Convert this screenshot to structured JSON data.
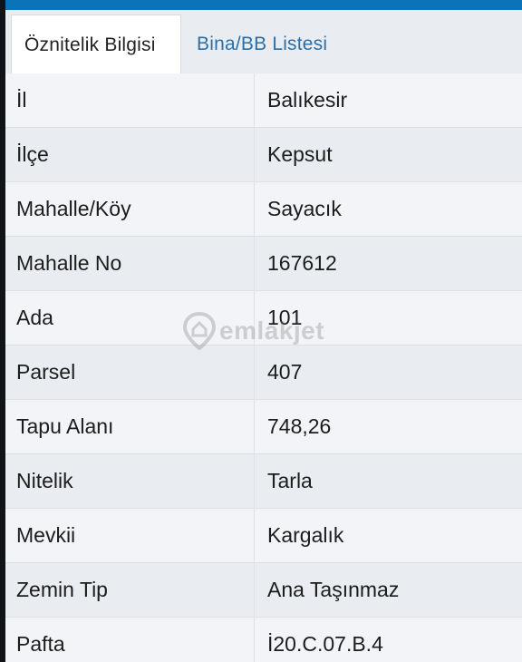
{
  "tabs": [
    {
      "label": "Öznitelik Bilgisi",
      "active": true
    },
    {
      "label": "Bina/BB Listesi",
      "active": false
    }
  ],
  "rows": [
    {
      "label": "İl",
      "value": "Balıkesir"
    },
    {
      "label": "İlçe",
      "value": "Kepsut"
    },
    {
      "label": "Mahalle/Köy",
      "value": "Sayacık"
    },
    {
      "label": "Mahalle No",
      "value": "167612"
    },
    {
      "label": "Ada",
      "value": "101"
    },
    {
      "label": "Parsel",
      "value": "407"
    },
    {
      "label": "Tapu Alanı",
      "value": "748,26"
    },
    {
      "label": "Nitelik",
      "value": "Tarla"
    },
    {
      "label": "Mevkii",
      "value": "Kargalık"
    },
    {
      "label": "Zemin Tip",
      "value": "Ana Taşınmaz"
    },
    {
      "label": "Pafta",
      "value": "İ20.C.07.B.4"
    }
  ],
  "watermark": {
    "text": "emlakjet",
    "icon": "location-pin-icon"
  },
  "colors": {
    "accent": "#0d73b8",
    "tab_inactive_text": "#2b6fa6",
    "row_odd": "#f2f4f7",
    "row_even": "#e9ecf0"
  }
}
